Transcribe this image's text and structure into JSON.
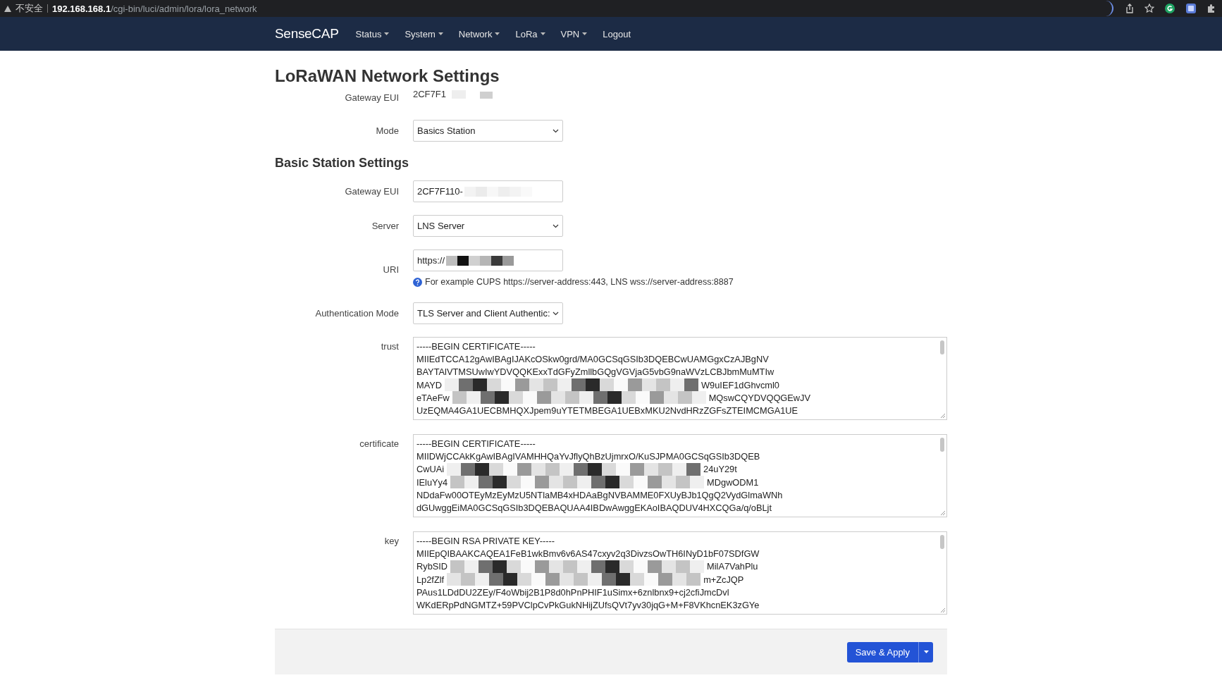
{
  "browser": {
    "security": "不安全",
    "url_host": "192.168.168.1",
    "url_path": "/cgi-bin/luci/admin/lora/lora_network"
  },
  "nav": {
    "brand": "SenseCAP",
    "items": [
      {
        "label": "Status",
        "dropdown": true
      },
      {
        "label": "System",
        "dropdown": true
      },
      {
        "label": "Network",
        "dropdown": true
      },
      {
        "label": "LoRa",
        "dropdown": true
      },
      {
        "label": "VPN",
        "dropdown": true
      },
      {
        "label": "Logout",
        "dropdown": false
      }
    ]
  },
  "title": "LoRaWAN Network Settings",
  "gateway_eui": {
    "label": "Gateway EUI",
    "value": "2CF7F1"
  },
  "mode": {
    "label": "Mode",
    "value": "Basics Station"
  },
  "section_title": "Basic Station Settings",
  "fields": [
    {
      "kind": "input",
      "label": "Gateway EUI",
      "parts": [
        {
          "kind": "text",
          "text": "2CF7F110-"
        },
        {
          "kind": "faint_mosaic"
        }
      ]
    },
    {
      "kind": "select",
      "label": "Server",
      "value": "LNS Server"
    },
    {
      "kind": "input",
      "label": "URI",
      "parts": [
        {
          "kind": "text",
          "text": "https://"
        },
        {
          "kind": "dark_mosaic"
        }
      ],
      "help": "For example CUPS https://server-address:443, LNS wss://server-address:8887"
    },
    {
      "kind": "select",
      "label": "Authentication Mode",
      "value": "TLS Server and Client Authentic:"
    }
  ],
  "textareas": [
    {
      "label": "trust",
      "lines": [
        [
          {
            "kind": "text",
            "text": "-----BEGIN CERTIFICATE-----"
          }
        ],
        [
          {
            "kind": "text",
            "text": "MIIEdTCCA12gAwIBAgIJAKcOSkw0grd/MA0GCSqGSIb3DQEBCwUAMGgxCzAJBgNV"
          }
        ],
        [
          {
            "kind": "text",
            "text": "BAYTAlVTMSUwIwYDVQQKExxTdGFyZmllbGQgVGVjaG5vbG9naWVzLCBJbmMuMTIw"
          }
        ],
        [
          {
            "kind": "text",
            "text": "MAYD"
          },
          {
            "kind": "mosaic"
          },
          {
            "kind": "text",
            "text": "W9uIEF1dGhvcml0"
          }
        ],
        [
          {
            "kind": "text",
            "text": "eTAeFw"
          },
          {
            "kind": "mosaic"
          },
          {
            "kind": "text",
            "text": "MQswCQYDVQQGEwJV"
          }
        ],
        [
          {
            "kind": "text",
            "text": "UzEQMA4GA1UECBMHQXJpem9uYTETMBEGA1UEBxMKU2NvdHRzZGFsZTEIMCMGA1UE"
          }
        ]
      ]
    },
    {
      "label": "certificate",
      "lines": [
        [
          {
            "kind": "text",
            "text": "-----BEGIN CERTIFICATE-----"
          }
        ],
        [
          {
            "kind": "text",
            "text": "MIIDWjCCAkKgAwIBAgIVAMHHQaYvJflyQhBzUjmrxO/KuSJPMA0GCSqGSIb3DQEB"
          }
        ],
        [
          {
            "kind": "text",
            "text": "CwUAi"
          },
          {
            "kind": "mosaic"
          },
          {
            "kind": "text",
            "text": "24uY29t"
          }
        ],
        [
          {
            "kind": "text",
            "text": "IEluYy4"
          },
          {
            "kind": "mosaic"
          },
          {
            "kind": "text",
            "text": "MDgwODM1"
          }
        ],
        [
          {
            "kind": "text",
            "text": "NDdaFw00OTEyMzEyMzU5NTlaMB4xHDAaBgNVBAMME0FXUyBJb1QgQ2VydGlmaWNh"
          }
        ],
        [
          {
            "kind": "text",
            "text": "dGUwggEiMA0GCSqGSIb3DQEBAQUAA4IBDwAwggEKAoIBAQDUV4HXCQGa/q/oBLjt"
          }
        ]
      ]
    },
    {
      "label": "key",
      "lines": [
        [
          {
            "kind": "text",
            "text": "-----BEGIN RSA PRIVATE KEY-----"
          }
        ],
        [
          {
            "kind": "text",
            "text": "MIIEpQIBAAKCAQEA1FeB1wkBmv6v6AS47cxyv2q3DivzsOwTH6INyD1bF07SDfGW"
          }
        ],
        [
          {
            "kind": "text",
            "text": "RybSID"
          },
          {
            "kind": "mosaic"
          },
          {
            "kind": "text",
            "text": "MilA7VahPlu"
          }
        ],
        [
          {
            "kind": "text",
            "text": "Lp2fZlf"
          },
          {
            "kind": "mosaic"
          },
          {
            "kind": "text",
            "text": "m+ZcJQP"
          }
        ],
        [
          {
            "kind": "text",
            "text": "PAus1LDdDU2ZEy/F4oWbij2B1P8d0hPnPHIF1uSimx+6znlbnx9+cj2cfiJmcDvl"
          }
        ],
        [
          {
            "kind": "text",
            "text": "WKdERpPdNGMTZ+59PVClpCvPkGukNHijZUfsQVt7yv30jqG+M+F8VKhcnEK3zGYe"
          }
        ]
      ]
    }
  ],
  "save_button": "Save & Apply"
}
